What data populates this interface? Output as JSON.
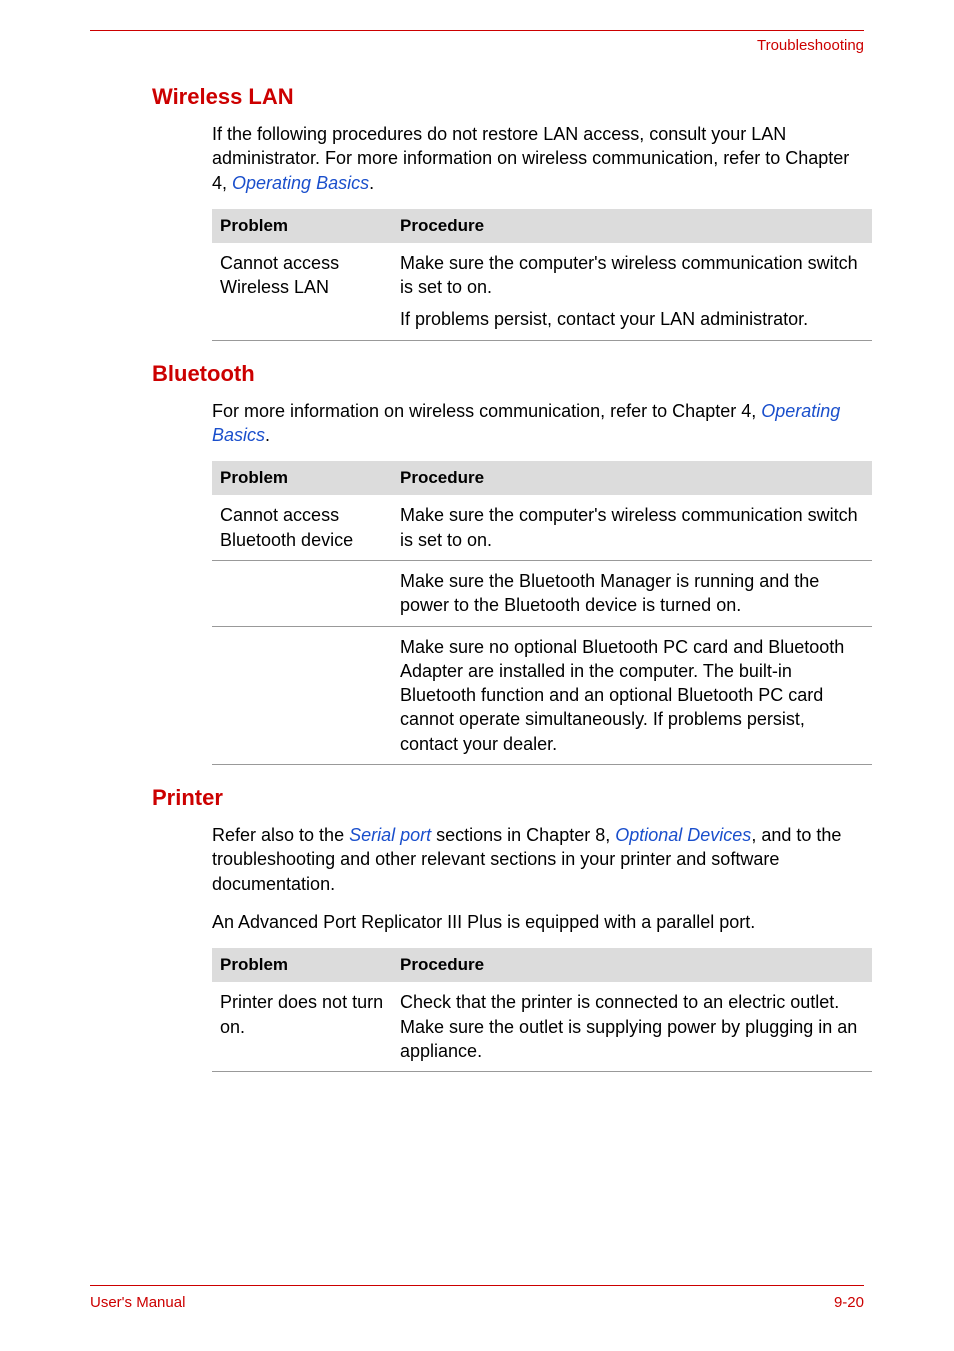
{
  "running_header": "Troubleshooting",
  "sections": {
    "wlan": {
      "title": "Wireless LAN",
      "intro_pre": "If the following procedures do not restore LAN access, consult your LAN administrator. For more information on wireless communication, refer to Chapter 4, ",
      "intro_link": "Operating Basics",
      "intro_post": ".",
      "th_problem": "Problem",
      "th_procedure": "Procedure",
      "row1_problem": "Cannot access Wireless LAN",
      "row1_proc1": "Make sure the computer's wireless communication switch is set to on.",
      "row1_proc2": "If problems persist, contact your LAN administrator."
    },
    "bluetooth": {
      "title": "Bluetooth",
      "intro_pre": "For more information on wireless communication, refer to Chapter 4, ",
      "intro_link": "Operating Basics",
      "intro_post": ".",
      "th_problem": "Problem",
      "th_procedure": "Procedure",
      "row1_problem": "Cannot access Bluetooth device",
      "row1_proc": "Make sure the computer's wireless communication switch is set to on.",
      "row2_proc": "Make sure the Bluetooth Manager is running and the power to the Bluetooth device is turned on.",
      "row3_proc": "Make sure no optional Bluetooth PC card and Bluetooth Adapter are installed in the computer. The built-in Bluetooth function and an optional Bluetooth PC card cannot operate simultaneously. If problems persist, contact your dealer."
    },
    "printer": {
      "title": "Printer",
      "intro_pre": "Refer also to the ",
      "intro_link1": "Serial port",
      "intro_mid": " sections in Chapter 8, ",
      "intro_link2": "Optional Devices",
      "intro_post": ", and to the troubleshooting and other relevant sections in your printer and software documentation.",
      "intro2": "An Advanced Port Replicator III Plus is equipped with a parallel port.",
      "th_problem": "Problem",
      "th_procedure": "Procedure",
      "row1_problem": "Printer does not turn on.",
      "row1_proc": "Check that the printer is connected to an electric outlet. Make sure the outlet is supplying power by plugging in an appliance."
    }
  },
  "footer": {
    "left": "User's Manual",
    "right": "9-20"
  }
}
